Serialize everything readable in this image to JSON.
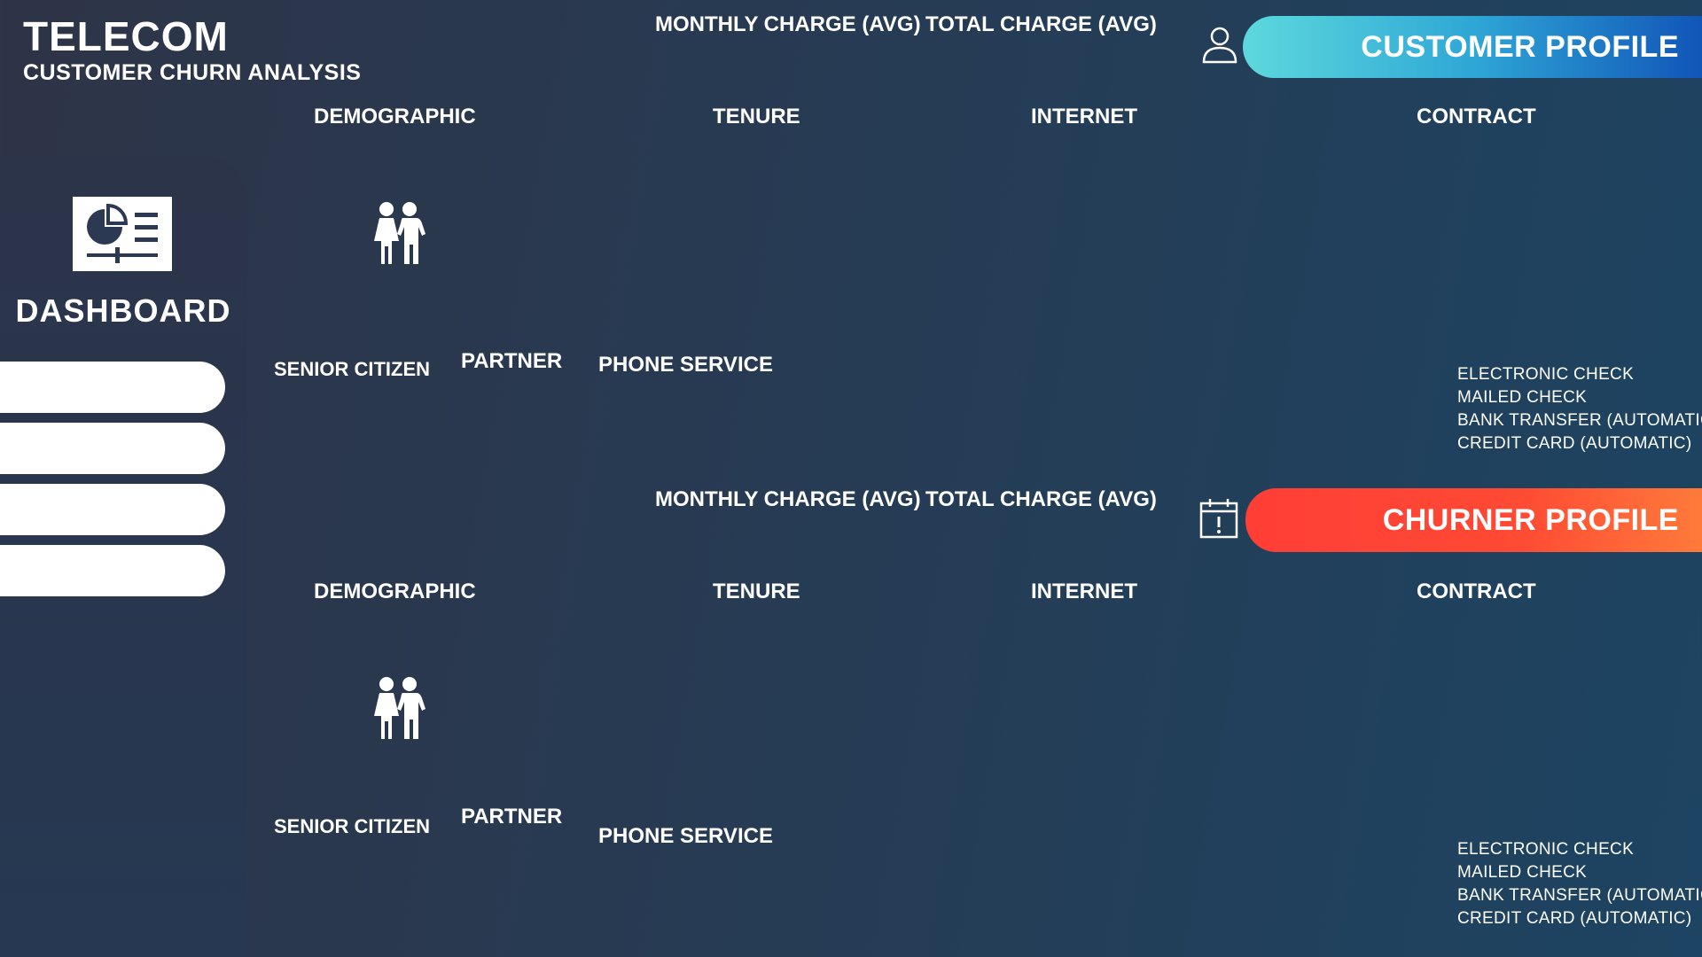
{
  "header": {
    "title": "TELECOM",
    "subtitle": "CUSTOMER CHURN ANALYSIS"
  },
  "sidebar": {
    "dashboard_label": "DASHBOARD",
    "nav_buttons": [
      "",
      "",
      "",
      ""
    ]
  },
  "customer_section": {
    "profile_label": "CUSTOMER PROFILE",
    "monthly_charge_label": "MONTHLY CHARGE (AVG)",
    "total_charge_label": "TOTAL CHARGE (AVG)",
    "demographic_label": "DEMOGRAPHIC",
    "tenure_label": "TENURE",
    "internet_label": "INTERNET",
    "contract_label": "CONTRACT",
    "senior_citizen_label": "SENIOR CITIZEN",
    "partner_label": "PARTNER",
    "phone_service_label": "PHONE SERVICE",
    "payment_methods": [
      "ELECTRONIC CHECK",
      "MAILED CHECK",
      "BANK TRANSFER (AUTOMATIC)",
      "CREDIT CARD (AUTOMATIC)"
    ]
  },
  "churner_section": {
    "profile_label": "CHURNER PROFILE",
    "monthly_charge_label": "MONTHLY CHARGE (AVG)",
    "total_charge_label": "TOTAL CHARGE (AVG)",
    "demographic_label": "DEMOGRAPHIC",
    "tenure_label": "TENURE",
    "internet_label": "INTERNET",
    "contract_label": "CONTRACT",
    "senior_citizen_label": "SENIOR CITIZEN",
    "partner_label": "PARTNER",
    "phone_service_label": "PHONE SERVICE",
    "payment_methods": [
      "ELECTRONIC CHECK",
      "MAILED CHECK",
      "BANK TRANSFER (AUTOMATIC)",
      "CREDIT CARD (AUTOMATIC)"
    ]
  },
  "icons": {
    "customer": "user-icon",
    "churner": "calendar-alert-icon",
    "dashboard": "dashboard-chart-icon",
    "demographic": "people-icon"
  },
  "colors": {
    "customer_accent": "#2fa7d6",
    "churner_accent": "#ff4a34"
  }
}
